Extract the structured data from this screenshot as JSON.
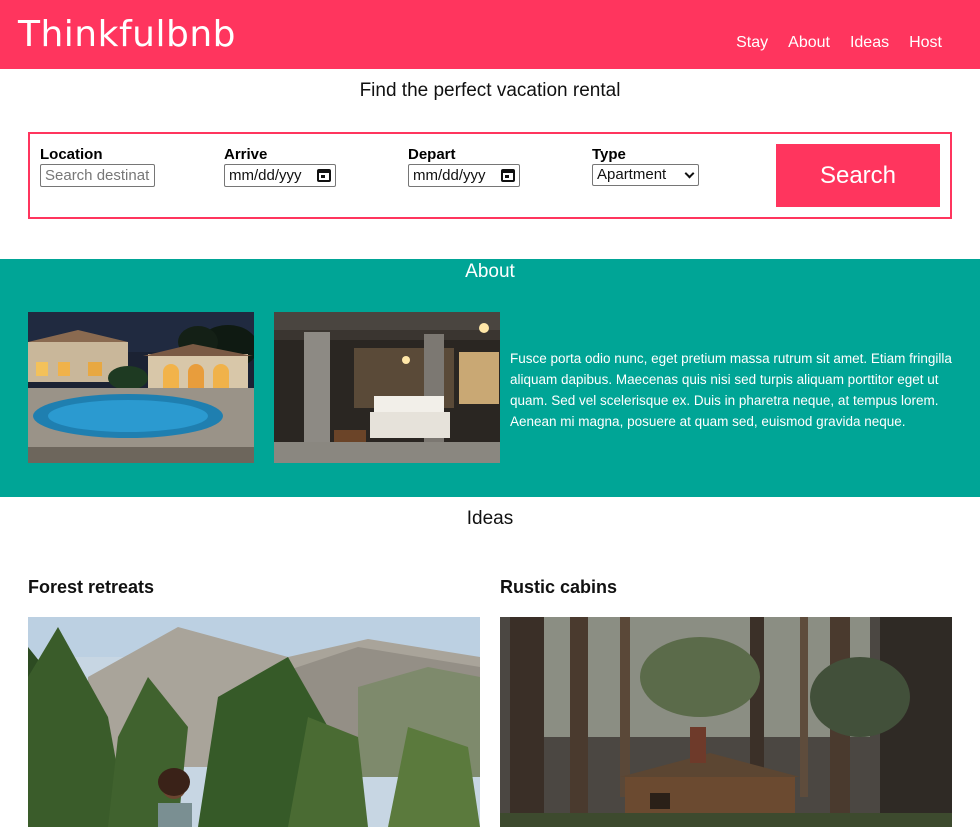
{
  "header": {
    "brand": "Thinkfulbnb",
    "nav": [
      "Stay",
      "About",
      "Ideas",
      "Host"
    ]
  },
  "search": {
    "title": "Find the perfect vacation rental",
    "location_label": "Location",
    "location_placeholder": "Search destinat",
    "arrive_label": "Arrive",
    "arrive_value": "mm/dd/yyy",
    "depart_label": "Depart",
    "depart_value": "mm/dd/yyy",
    "type_label": "Type",
    "type_value": "Apartment",
    "button": "Search"
  },
  "about": {
    "title": "About",
    "text": "Fusce porta odio nunc, eget pretium massa rutrum sit amet. Etiam fringilla aliquam dapibus. Maecenas quis nisi sed turpis aliquam porttitor eget ut quam. Sed vel scelerisque ex. Duis in pharetra neque, at tempus lorem. Aenean mi magna, posuere at quam sed, euismod gravida neque."
  },
  "ideas": {
    "title": "Ideas",
    "items": [
      {
        "heading": "Forest retreats"
      },
      {
        "heading": "Rustic cabins"
      }
    ]
  },
  "colors": {
    "brand": "#ff355e",
    "about_bg": "#00a596"
  }
}
